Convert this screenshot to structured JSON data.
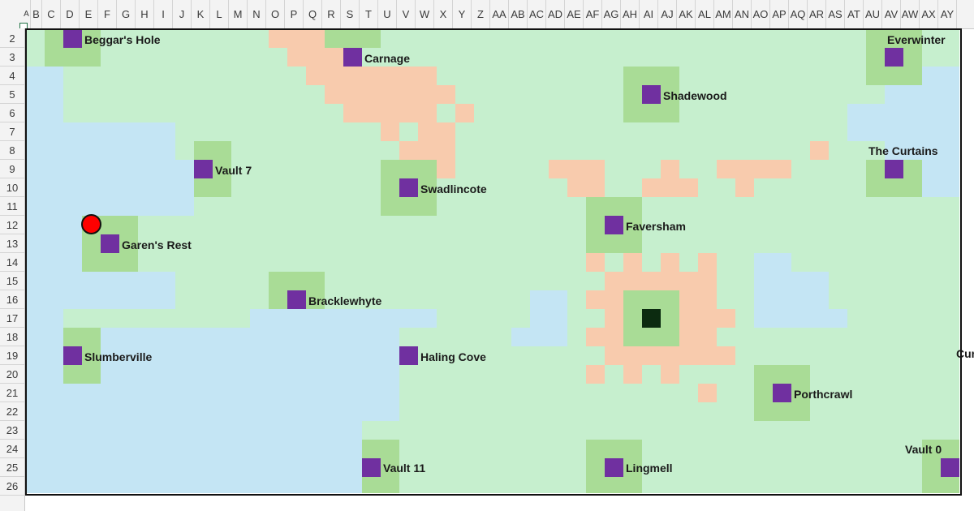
{
  "columns": [
    "A",
    "B",
    "C",
    "D",
    "E",
    "F",
    "G",
    "H",
    "I",
    "J",
    "K",
    "L",
    "M",
    "N",
    "O",
    "P",
    "Q",
    "R",
    "S",
    "T",
    "U",
    "V",
    "W",
    "X",
    "Y",
    "Z",
    "AA",
    "AB",
    "AC",
    "AD",
    "AE",
    "AF",
    "AG",
    "AH",
    "AI",
    "AJ",
    "AK",
    "AL",
    "AM",
    "AN",
    "AO",
    "AP",
    "AQ",
    "AR",
    "AS",
    "AT",
    "AU",
    "AV",
    "AW",
    "AX",
    "AY"
  ],
  "rows": [
    "2",
    "3",
    "4",
    "5",
    "6",
    "7",
    "8",
    "9",
    "10",
    "11",
    "12",
    "13",
    "14",
    "15",
    "16",
    "17",
    "18",
    "19",
    "20",
    "21",
    "22",
    "23",
    "24",
    "25",
    "26"
  ],
  "locations": [
    {
      "name": "Beggar's Hole"
    },
    {
      "name": "Carnage"
    },
    {
      "name": "Everwinter"
    },
    {
      "name": "Shadewood"
    },
    {
      "name": "The Curtains"
    },
    {
      "name": "Vault 7"
    },
    {
      "name": "Swadlincote"
    },
    {
      "name": "Faversham"
    },
    {
      "name": "Garen's Rest"
    },
    {
      "name": "Bracklewhyte"
    },
    {
      "name": "Slumberville"
    },
    {
      "name": "Haling Cove"
    },
    {
      "name": "Porthcrawl"
    },
    {
      "name": "Vault 11"
    },
    {
      "name": "Lingmell"
    },
    {
      "name": "Vault 0"
    }
  ],
  "offscreen_label": "Cur",
  "colors": {
    "land": "#c6efce",
    "water": "#c4e5f4",
    "wasteland": "#f8cbad",
    "town_zone": "#a9dc96",
    "town": "#7030a0",
    "home_base": "#0c2b10",
    "player": "#ff0000"
  }
}
